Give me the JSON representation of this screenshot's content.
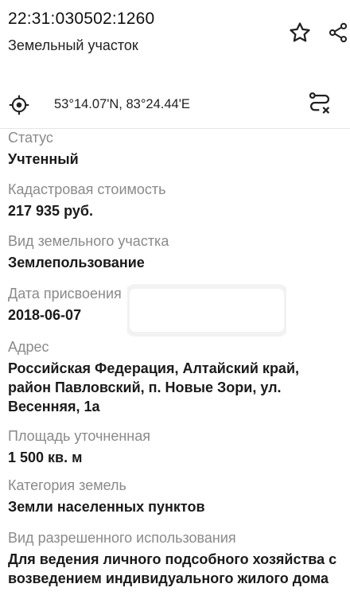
{
  "header": {
    "cadastral_number": "22:31:030502:1260",
    "subtitle": "Земельный участок",
    "star_icon": "star-icon",
    "share_icon": "share-icon"
  },
  "coords_bar": {
    "coordinates": "53°14.07'N, 83°24.44'E",
    "locate_icon": "crosshair-icon",
    "route_icon": "route-clear-icon"
  },
  "fields": [
    {
      "label": "Статус",
      "value": "Учтенный"
    },
    {
      "label": "Кадастровая стоимость",
      "value": "217 935 руб."
    },
    {
      "label": "Вид земельного участка",
      "value": "Землепользование"
    },
    {
      "label": "Дата присвоения",
      "value": "2018-06-07"
    },
    {
      "label": "Адрес",
      "value": "Российская Федерация, Алтайский край, район Павловский, п. Новые Зори, ул. Весенняя, 1а"
    },
    {
      "label": "Площадь уточненная",
      "value": "1 500 кв. м"
    },
    {
      "label": "Категория земель",
      "value": "Земли населенных пунктов"
    },
    {
      "label": "Вид разрешенного использования",
      "value": "Для ведения личного подсобного хозяйства с возведением индивидуального жилого дома"
    }
  ],
  "colors": {
    "label": "#8a8a8a",
    "value": "#1a1a1a",
    "icon": "#222222"
  }
}
